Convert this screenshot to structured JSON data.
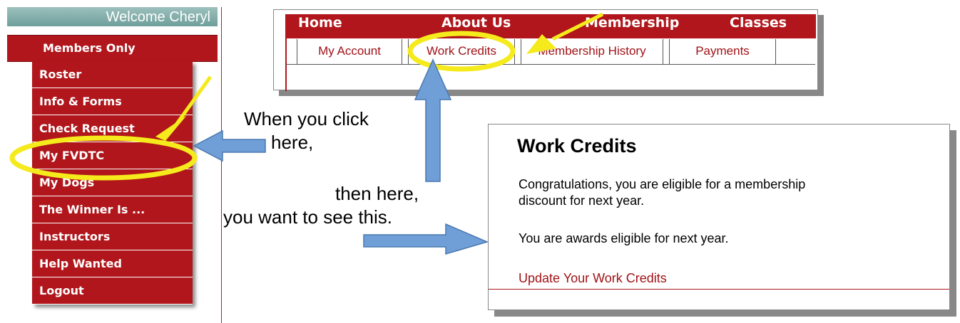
{
  "sidebar": {
    "welcome": "Welcome Cheryl",
    "members_only": "Members Only",
    "items": [
      {
        "label": "Roster"
      },
      {
        "label": "Info & Forms"
      },
      {
        "label": "Check Request"
      },
      {
        "label": "My FVDTC"
      },
      {
        "label": "My Dogs"
      },
      {
        "label": "The Winner Is ..."
      },
      {
        "label": "Instructors"
      },
      {
        "label": "Help Wanted"
      },
      {
        "label": "Logout"
      }
    ]
  },
  "topnav": {
    "links": [
      "Home",
      "About Us",
      "Membership",
      "Classes"
    ],
    "tabs": [
      "My Account",
      "Work Credits",
      "Membership History",
      "Payments"
    ]
  },
  "work_credits": {
    "title": "Work Credits",
    "line1": "Congratulations, you are eligible for a membership",
    "line2": "discount for next year.",
    "line3": "You are awards eligible for next year.",
    "link": "Update Your Work Credits"
  },
  "annotations": {
    "step1_a": "When you click",
    "step1_b": "here,",
    "step2": "then here,",
    "step3": "you want to see this."
  },
  "colors": {
    "brand_red": "#b0161b",
    "highlight_yellow": "#f5ea1b",
    "arrow_blue": "#6f9fd6",
    "welcome_teal": "#7fa9a5"
  }
}
